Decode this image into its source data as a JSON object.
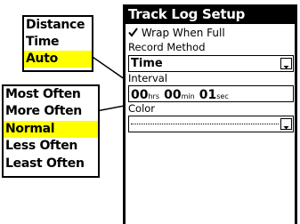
{
  "record_method_popup": {
    "options": [
      "Distance",
      "Time",
      "Auto"
    ],
    "selected": "Auto"
  },
  "interval_popup": {
    "options": [
      "Most Often",
      "More Often",
      "Normal",
      "Less Often",
      "Least Often"
    ],
    "selected": "Normal"
  },
  "panel": {
    "title": "Track Log Setup",
    "wrap_label": "Wrap When Full",
    "wrap_checked": true,
    "record_method_label": "Record Method",
    "record_method_value": "Time",
    "interval_label": "Interval",
    "interval": {
      "hours": "00",
      "hours_unit": "hrs",
      "minutes": "00",
      "minutes_unit": "min",
      "seconds": "01",
      "seconds_unit": "sec"
    },
    "color_label": "Color",
    "color_value": ""
  },
  "colors": {
    "highlight": "#ffff00",
    "panel_bg": "#000000",
    "title_text": "#ffffff"
  },
  "icons": {
    "checkbox": "checkmark-icon",
    "dropdown": "dropdown-arrow-icon"
  }
}
